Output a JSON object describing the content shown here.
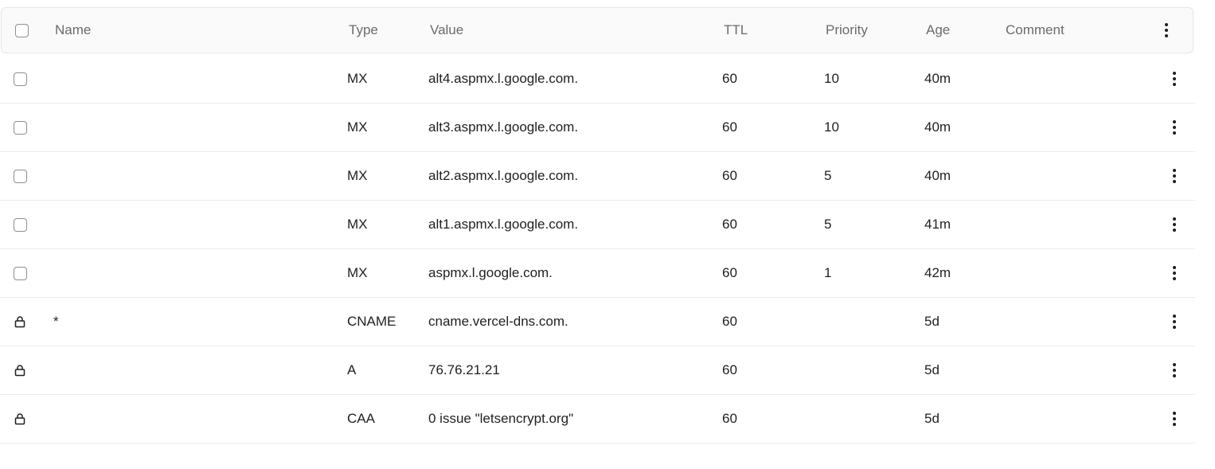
{
  "columns": {
    "name": "Name",
    "type": "Type",
    "value": "Value",
    "ttl": "TTL",
    "priority": "Priority",
    "age": "Age",
    "comment": "Comment"
  },
  "icons": {
    "header_menu": "more-vertical-icon",
    "row_menu": "more-vertical-icon",
    "locked": "lock-icon",
    "select": "checkbox"
  },
  "records": [
    {
      "name": "",
      "type": "MX",
      "value": "alt4.aspmx.l.google.com.",
      "ttl": "60",
      "priority": "10",
      "age": "40m",
      "comment": "",
      "locked": false
    },
    {
      "name": "",
      "type": "MX",
      "value": "alt3.aspmx.l.google.com.",
      "ttl": "60",
      "priority": "10",
      "age": "40m",
      "comment": "",
      "locked": false
    },
    {
      "name": "",
      "type": "MX",
      "value": "alt2.aspmx.l.google.com.",
      "ttl": "60",
      "priority": "5",
      "age": "40m",
      "comment": "",
      "locked": false
    },
    {
      "name": "",
      "type": "MX",
      "value": "alt1.aspmx.l.google.com.",
      "ttl": "60",
      "priority": "5",
      "age": "41m",
      "comment": "",
      "locked": false
    },
    {
      "name": "",
      "type": "MX",
      "value": "aspmx.l.google.com.",
      "ttl": "60",
      "priority": "1",
      "age": "42m",
      "comment": "",
      "locked": false
    },
    {
      "name": "*",
      "type": "CNAME",
      "value": "cname.vercel-dns.com.",
      "ttl": "60",
      "priority": "",
      "age": "5d",
      "comment": "",
      "locked": true
    },
    {
      "name": "",
      "type": "A",
      "value": "76.76.21.21",
      "ttl": "60",
      "priority": "",
      "age": "5d",
      "comment": "",
      "locked": true
    },
    {
      "name": "",
      "type": "CAA",
      "value": "0 issue \"letsencrypt.org\"",
      "ttl": "60",
      "priority": "",
      "age": "5d",
      "comment": "",
      "locked": true
    }
  ]
}
